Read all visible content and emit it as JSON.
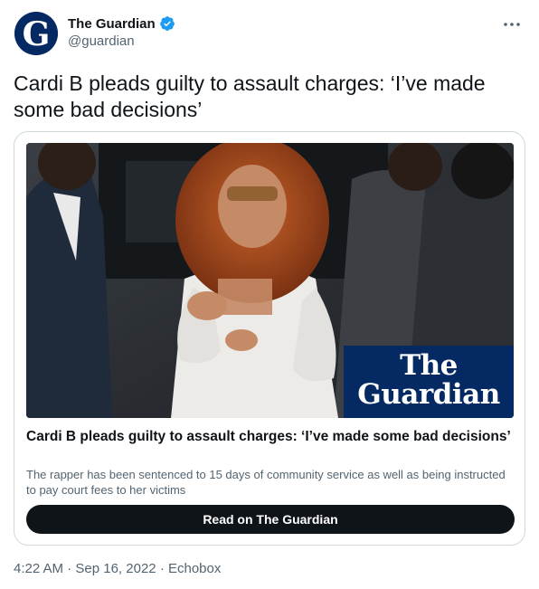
{
  "account": {
    "display_name": "The Guardian",
    "handle": "@guardian",
    "avatar_letter": "G",
    "avatar_color": "#052962",
    "verified_icon": "verified-badge-icon",
    "verified_color": "#1d9bf0",
    "more_icon": "more-horizontal-icon"
  },
  "tweet": {
    "text": "Cardi B pleads guilty to assault charges: ‘I’ve made some bad decisions’"
  },
  "card": {
    "image_logo_line1": "The",
    "image_logo_line2": "Guardian",
    "title": "Cardi B pleads guilty to assault charges: ‘I’ve made some bad decisions’",
    "description": "The rapper has been sentenced to 15 days of community service as well as being instructed to pay court fees to her victims",
    "button_label": "Read on The Guardian"
  },
  "meta": {
    "time": "4:22 AM",
    "separator": "·",
    "date": "Sep 16, 2022",
    "source": "Echobox"
  }
}
